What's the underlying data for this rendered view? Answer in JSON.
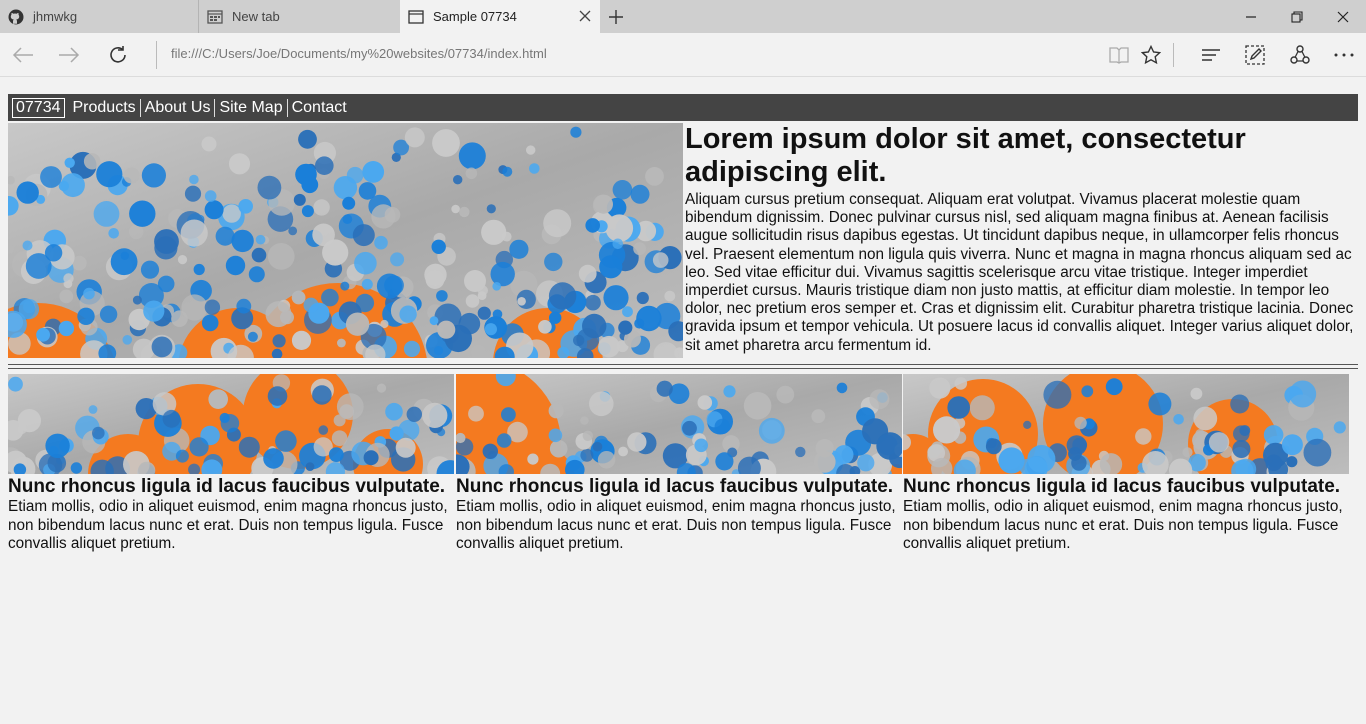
{
  "browser": {
    "tabs": [
      {
        "title": "jhmwkg",
        "icon": "github-icon"
      },
      {
        "title": "New tab",
        "icon": "new-tab-page-icon"
      },
      {
        "title": "Sample 07734",
        "icon": "page-icon",
        "active": true
      }
    ],
    "address": "file:///C:/Users/Joe/Documents/my%20websites/07734/index.html"
  },
  "site": {
    "brand": "07734",
    "nav": [
      "Products",
      "About Us",
      "Site Map",
      "Contact"
    ],
    "hero": {
      "title": "Lorem ipsum dolor sit amet, consectetur adipiscing elit.",
      "body": "Aliquam cursus pretium consequat. Aliquam erat volutpat. Vivamus placerat molestie quam bibendum dignissim. Donec pulvinar cursus nisl, sed aliquam magna finibus at. Aenean facilisis augue sollicitudin risus dapibus egestas. Ut tincidunt dapibus neque, in ullamcorper felis rhoncus vel. Praesent elementum non ligula quis viverra. Nunc et magna in magna rhoncus aliquam sed ac leo. Sed vitae efficitur dui. Vivamus sagittis scelerisque arcu vitae tristique. Integer imperdiet imperdiet cursus. Mauris tristique diam non justo mattis, at efficitur diam molestie. In tempor leo dolor, nec pretium eros semper et. Cras et dignissim elit. Curabitur pharetra tristique lacinia. Donec gravida ipsum et tempor vehicula. Ut posuere lacus id convallis aliquet. Integer varius aliquet dolor, sit amet pharetra arcu fermentum id."
    },
    "cards": [
      {
        "title": "Nunc rhoncus ligula id lacus faucibus vulputate.",
        "body": "Etiam mollis, odio in aliquet euismod, enim magna rhoncus justo, non bibendum lacus nunc et erat. Duis non tempus ligula. Fusce convallis aliquet pretium."
      },
      {
        "title": "Nunc rhoncus ligula id lacus faucibus vulputate.",
        "body": "Etiam mollis, odio in aliquet euismod, enim magna rhoncus justo, non bibendum lacus nunc et erat. Duis non tempus ligula. Fusce convallis aliquet pretium."
      },
      {
        "title": "Nunc rhoncus ligula id lacus faucibus vulputate.",
        "body": "Etiam mollis, odio in aliquet euismod, enim magna rhoncus justo, non bibendum lacus nunc et erat. Duis non tempus ligula. Fusce convallis aliquet pretium."
      }
    ]
  },
  "colors": {
    "accent_orange": "#f47a20",
    "dot_blue": "#1a7fd9",
    "dot_light_blue": "#4aa8f0",
    "nav_bg": "#444444"
  }
}
